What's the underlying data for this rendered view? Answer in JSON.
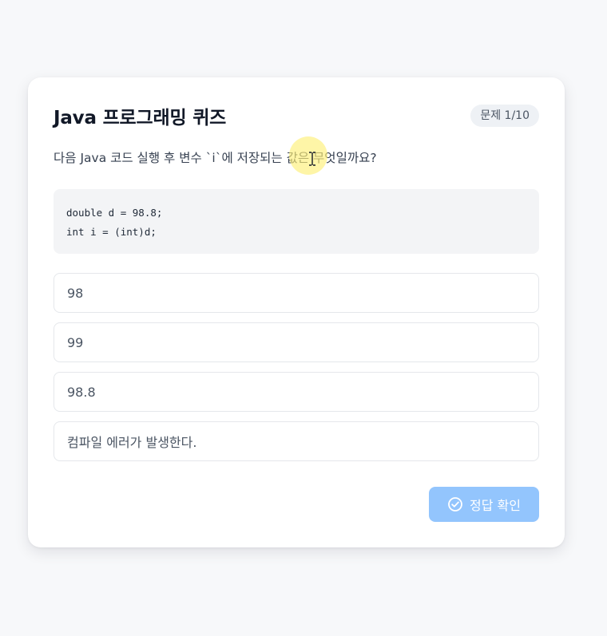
{
  "quiz": {
    "title": "Java 프로그래밍 퀴즈",
    "progress": "문제 1/10",
    "question": "다음 Java 코드 실행 후 변수 `i`에 저장되는 값은 무엇일까요?",
    "code_lines": [
      "double d = 98.8;",
      "int i = (int)d;"
    ],
    "options": [
      "98",
      "99",
      "98.8",
      "컴파일 에러가 발생한다."
    ],
    "submit_label": "정답 확인",
    "submit_icon": "check-circle-icon"
  },
  "colors": {
    "background": "#f7f8fa",
    "card": "#ffffff",
    "submit_disabled": "#93c5fd",
    "cursor_highlight": "#fdf078"
  }
}
